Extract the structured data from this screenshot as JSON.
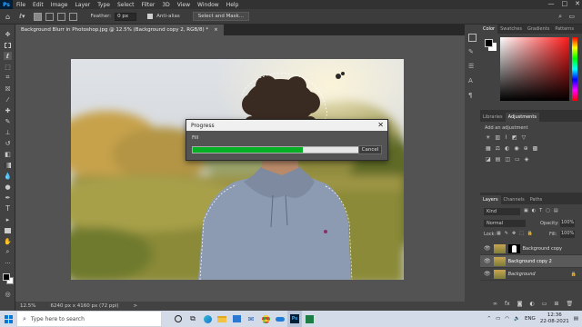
{
  "menubar": {
    "logo": "Ps",
    "items": [
      "File",
      "Edit",
      "Image",
      "Layer",
      "Type",
      "Select",
      "Filter",
      "3D",
      "View",
      "Window",
      "Help"
    ],
    "controls": [
      "—",
      "□",
      "✕"
    ]
  },
  "options": {
    "feather_label": "Feather:",
    "feather_value": "0 px",
    "antialias_label": "Anti-alias",
    "select_mask_label": "Select and Mask..."
  },
  "document": {
    "tab_title": "Background Blurr in Photoshop.jpg @ 12.5% (Background copy 2, RGB/8) *",
    "tab_close": "×"
  },
  "status": {
    "zoom": "12.5%",
    "info": "6240 px x 4160 px (72 ppi)",
    "arrow": ">"
  },
  "dialog": {
    "title": "Progress",
    "close": "✕",
    "label": "Fill",
    "progress": 0.66,
    "cancel": "Cancel"
  },
  "panels": {
    "color_tabs": [
      "Color",
      "Swatches",
      "Gradients",
      "Patterns"
    ],
    "adjust_tabs": [
      "Libraries",
      "Adjustments"
    ],
    "add_adjustment": "Add an adjustment",
    "layers_tabs": [
      "Layers",
      "Channels",
      "Paths"
    ],
    "kind": "Kind",
    "blend_mode": "Normal",
    "opacity_label": "Opacity:",
    "opacity_value": "100%",
    "lock_label": "Lock:",
    "fill_label": "Fill:",
    "fill_value": "100%",
    "layers": [
      "Background copy",
      "Background copy 2",
      "Background"
    ]
  },
  "taskbar": {
    "search_placeholder": "Type here to search",
    "language": "ENG",
    "time": "12:36",
    "date": "22-08-2021",
    "ps_label": "Ps"
  },
  "colors": {
    "progress": "#06b025",
    "accent": "#31a8ff"
  }
}
